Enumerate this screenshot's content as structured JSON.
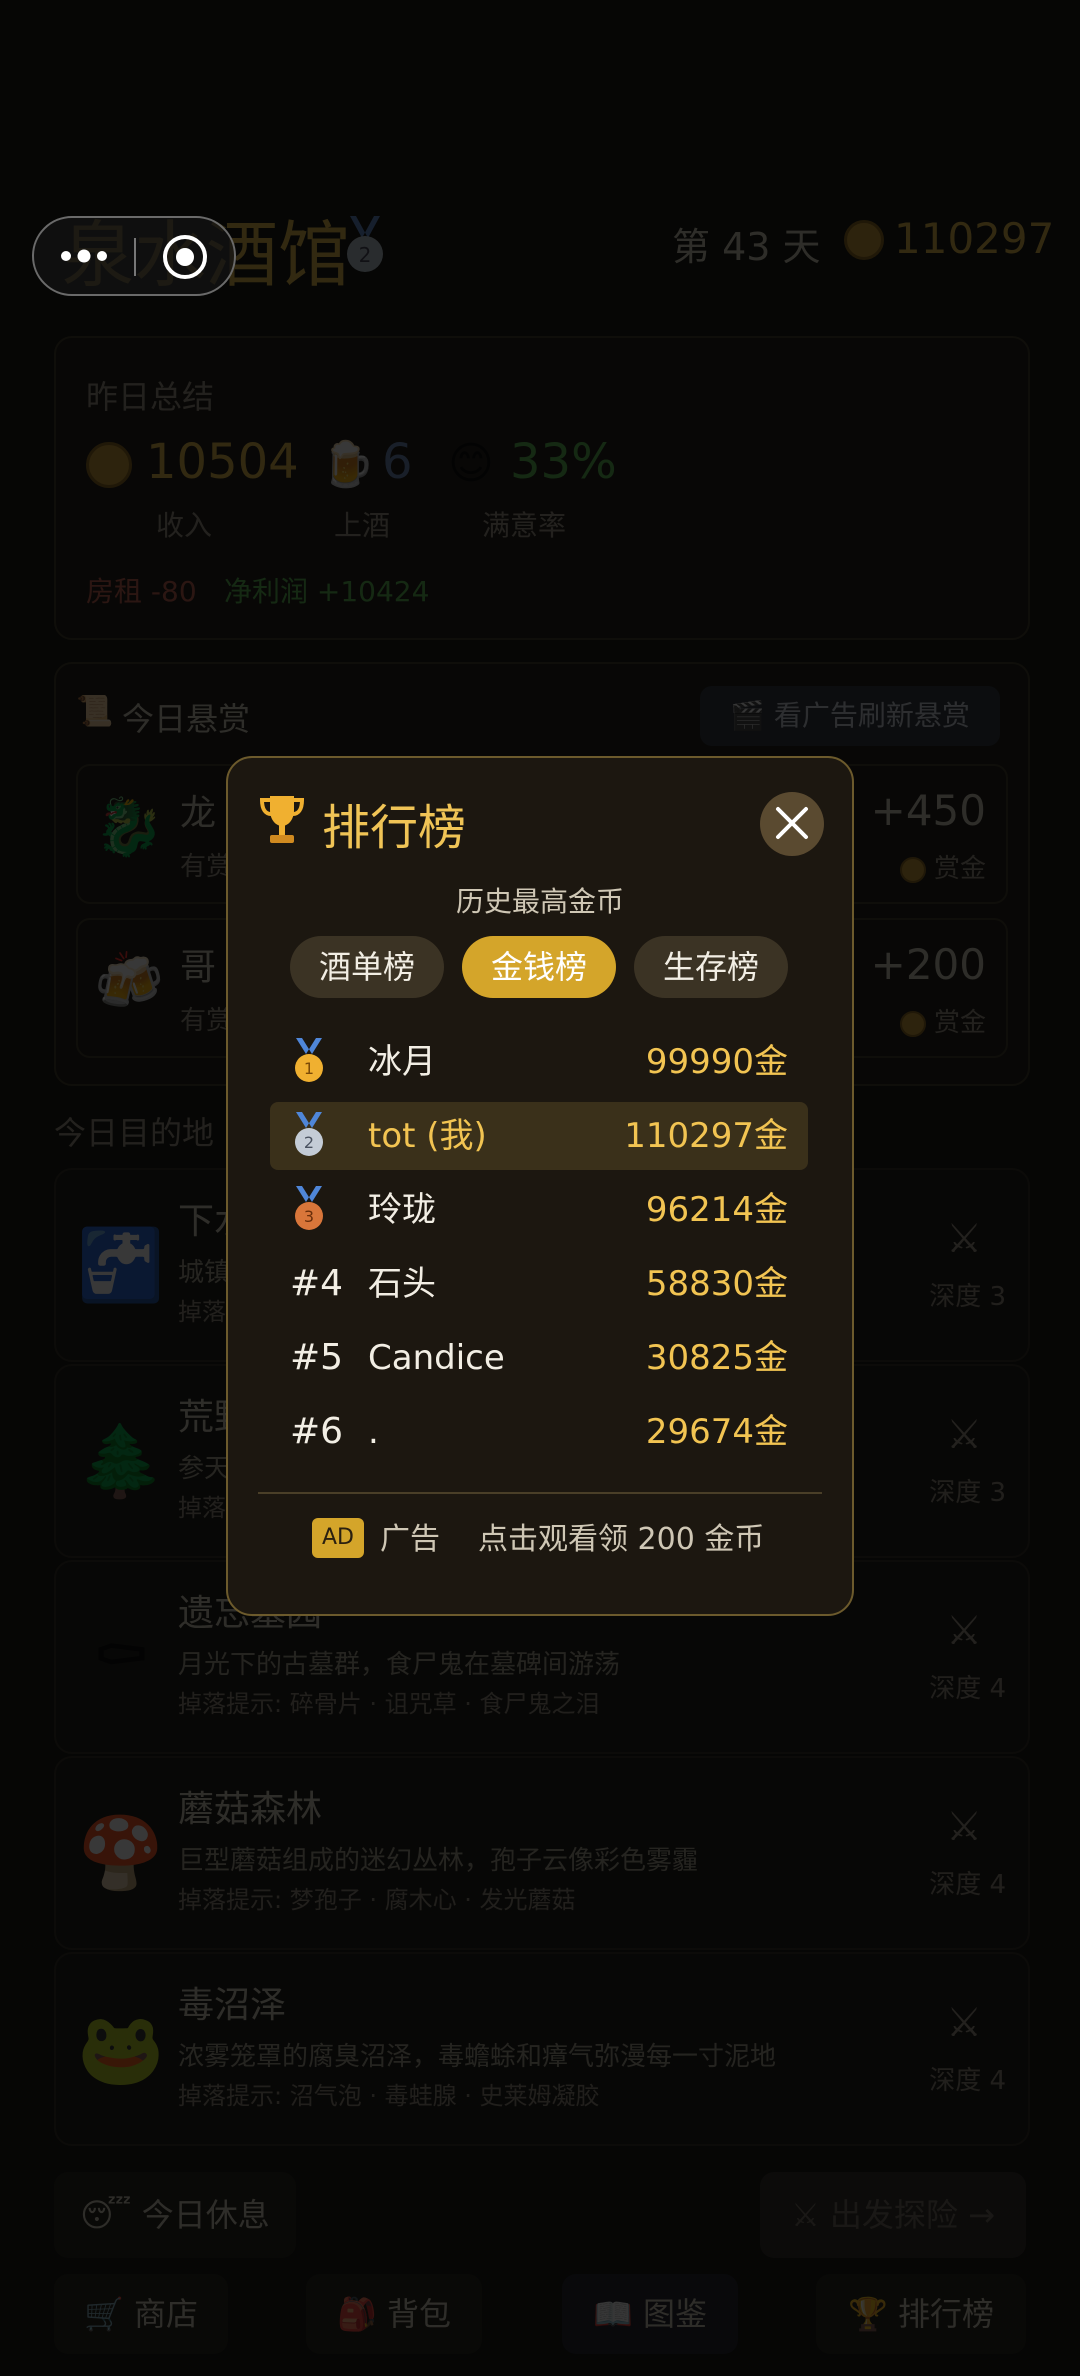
{
  "header": {
    "title": "泉水酒馆",
    "day": "第 43 天",
    "gold": "110297"
  },
  "summary": {
    "heading": "昨日总结",
    "income_value": "10504",
    "income_label": "收入",
    "drinks_value": "6",
    "drinks_label": "上酒",
    "satisfaction_value": "33%",
    "satisfaction_label": "满意率",
    "rent": "房租 -80",
    "net_profit": "净利润 +10424"
  },
  "bounty": {
    "heading": "今日悬赏",
    "refresh_button": "看广告刷新悬赏",
    "items": [
      {
        "title": "龙",
        "sub": "有赏",
        "reward": "+450",
        "reward_label": "赏金"
      },
      {
        "title": "哥",
        "sub": "有赏",
        "reward": "+200",
        "reward_label": "赏金"
      }
    ]
  },
  "destinations": {
    "heading": "今日目的地",
    "items": [
      {
        "title": "下水",
        "desc": "城镇",
        "drop": "掉落",
        "depth": "深度 3"
      },
      {
        "title": "荒野",
        "desc": "参天",
        "drop": "掉落",
        "depth": "深度 3"
      },
      {
        "title": "遗忘墓园",
        "desc": "月光下的古墓群，食尸鬼在墓碑间游荡",
        "drop": "掉落提示: 碎骨片 · 诅咒草 · 食尸鬼之泪",
        "depth": "深度 4"
      },
      {
        "title": "蘑菇森林",
        "desc": "巨型蘑菇组成的迷幻丛林，孢子云像彩色雾霾",
        "drop": "掉落提示: 梦孢子 · 腐木心 · 发光蘑菇",
        "depth": "深度 4"
      },
      {
        "title": "毒沼泽",
        "desc": "浓雾笼罩的腐臭沼泽，毒蟾蜍和瘴气弥漫每一寸泥地",
        "drop": "掉落提示: 沼气泡 · 毒蛙腺 · 史莱姆凝胶",
        "depth": "深度 4"
      }
    ]
  },
  "actions": {
    "rest": "今日休息",
    "explore": "出发探险 →"
  },
  "bottom_nav": [
    {
      "label": "商店"
    },
    {
      "label": "背包"
    },
    {
      "label": "图鉴"
    },
    {
      "label": "排行榜"
    }
  ],
  "modal": {
    "title": "排行榜",
    "subtitle": "历史最高金币",
    "tabs": [
      {
        "label": "酒单榜"
      },
      {
        "label": "金钱榜"
      },
      {
        "label": "生存榜"
      }
    ],
    "active_tab": "金钱榜",
    "rows": [
      {
        "rank": "1",
        "name": "冰月",
        "score": "99990金"
      },
      {
        "rank": "2",
        "name": "tot (我)",
        "score": "110297金"
      },
      {
        "rank": "3",
        "name": "玲珑",
        "score": "96214金"
      },
      {
        "rank": "#4",
        "name": "石头",
        "score": "58830金"
      },
      {
        "rank": "#5",
        "name": "Candice",
        "score": "30825金"
      },
      {
        "rank": "#6",
        "name": ".",
        "score": "29674金"
      }
    ],
    "ad_badge": "AD",
    "ad_label": "广告",
    "ad_text": "点击观看领 200 金币"
  },
  "colors": {
    "accent": "#d4a52a",
    "gold_text": "#f2c452",
    "modal_bg": "#1c1710"
  }
}
